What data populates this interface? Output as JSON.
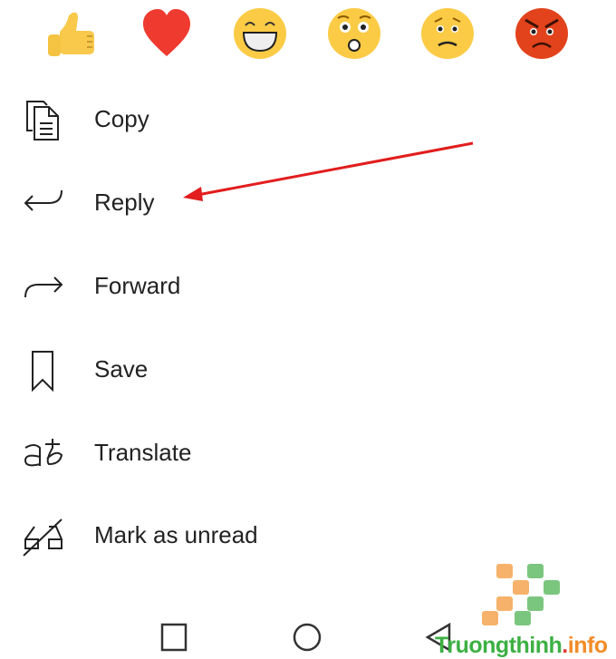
{
  "reactions": [
    {
      "name": "thumbs-up",
      "color": "#f8c94a"
    },
    {
      "name": "heart",
      "color": "#ef3a2f"
    },
    {
      "name": "laughing",
      "color": "#fbcb45"
    },
    {
      "name": "surprised",
      "color": "#fbcb45"
    },
    {
      "name": "sad",
      "color": "#fbcb45"
    },
    {
      "name": "angry",
      "color": "#e2431c"
    }
  ],
  "menu": [
    {
      "label": "Copy",
      "icon": "copy-icon"
    },
    {
      "label": "Reply",
      "icon": "reply-icon"
    },
    {
      "label": "Forward",
      "icon": "forward-icon"
    },
    {
      "label": "Save",
      "icon": "bookmark-icon"
    },
    {
      "label": "Translate",
      "icon": "translate-icon"
    },
    {
      "label": "Mark as unread",
      "icon": "mark-unread-icon"
    }
  ],
  "annotation": {
    "color": "#e21d1d",
    "points_to": "Reply"
  },
  "navbar": [
    "recents",
    "home",
    "back"
  ],
  "watermark": {
    "brand": "Truongthinh",
    "dot": ".",
    "tld": "info",
    "colors": [
      "#f6b26b",
      "#7bc67e"
    ]
  }
}
